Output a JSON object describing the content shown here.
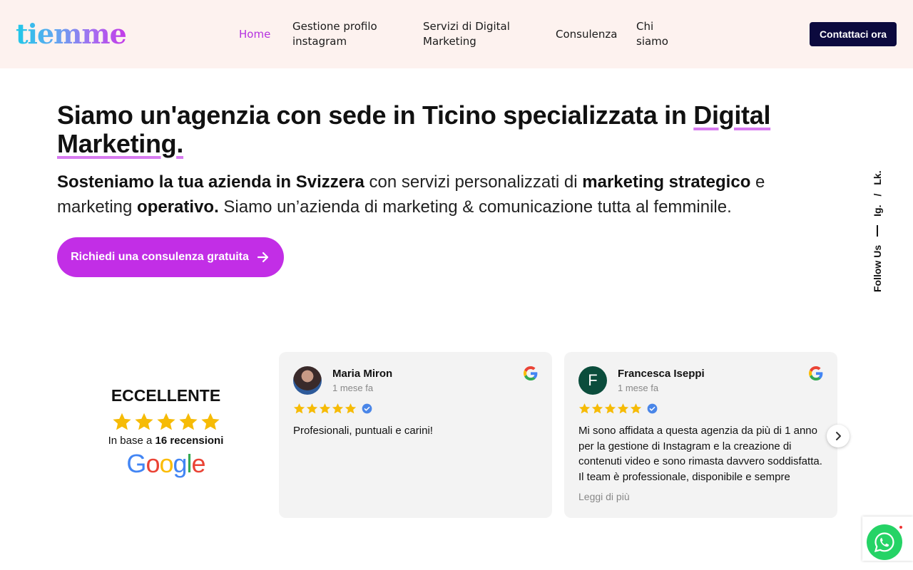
{
  "header": {
    "logo": "tiemme",
    "nav": [
      {
        "label": "Home"
      },
      {
        "label": "Gestione profilo instagram"
      },
      {
        "label": "Servizi di Digital Marketing"
      },
      {
        "label": "Consulenza"
      },
      {
        "label": "Chi siamo"
      }
    ],
    "cta": "Contattaci ora"
  },
  "hero": {
    "title_part1": "Siamo un'agenzia con sede in Ticino specializzata in ",
    "title_highlight1": "Digital",
    "title_highlight2": "Marketing",
    "title_end": ".",
    "sub_b1": "Sosteniamo la tua azienda in Svizzera",
    "sub_t1": " con servizi personalizzati di ",
    "sub_b2": "marketing strategico",
    "sub_t2": " e marketing ",
    "sub_b3": "operativo.",
    "sub_t3": " Siamo un’azienda di marketing & comunicazione tutta al femminile.",
    "cta": "Richiedi una consulenza gratuita"
  },
  "follow": {
    "label": "Follow Us",
    "ig": "Ig.",
    "sep": "/",
    "lk": "Lk."
  },
  "rating": {
    "title": "ECCELLENTE",
    "stars": 5,
    "base_prefix": "In base a ",
    "base_count": "16 recensioni",
    "google": [
      "G",
      "o",
      "o",
      "g",
      "l",
      "e"
    ]
  },
  "reviews": [
    {
      "name": "Maria Miron",
      "date": "1 mese fa",
      "text": "Profesionali, puntuali e carini!"
    },
    {
      "name": "Francesca Iseppi",
      "initial": "F",
      "date": "1 mese fa",
      "text": "Mi sono affidata a questa agenzia da più di 1 anno per la gestione di Instagram e la creazione di contenuti video e sono rimasta davvero soddisfatta. Il team è professionale, disponibile e sempre attento alle esigenze.",
      "read_more": "Leggi di più"
    }
  ],
  "colors": {
    "accent": "#c22ee6",
    "nav_active": "#b431e0",
    "header_bg": "#fdf2ef",
    "cta_dark": "#0c0a3e",
    "star": "#f6bb06",
    "whatsapp": "#25d366"
  }
}
